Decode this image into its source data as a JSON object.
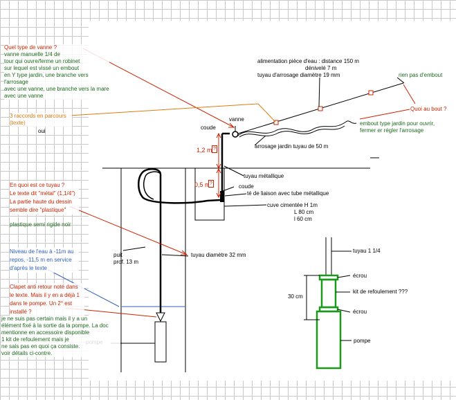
{
  "labels": {
    "alimentation": "alimentation pièce d'eau : distance 150 m",
    "denivele": "dénivelé 7 m",
    "tuyau_19mm": "tuyau d'arrosage diamètre 19 mm",
    "vanne": "vanne",
    "coude_top": "coude",
    "arrosage_jardin": "arrosage jardin tuyau de 50 m",
    "dim_1_2m": "1,2 m",
    "dim_0_5m": "0,5 m",
    "question_mark": "?",
    "tuyau_metallique": "tuyau métallique",
    "coude_bottom": "coude",
    "te_liaison": "té de liaison avec tube métallique",
    "cuve": "cuve cimentée H 1m",
    "cuve_l": "L 80 cm",
    "cuve_l2": "l 60 cm",
    "puits": "puit\nprof. 13 m",
    "tuyau_32mm": "tuyau diamètre 32 mm",
    "pompe": "pompe"
  },
  "detail": {
    "tuyau": "tuyau 1 1/4",
    "ecrou": "écrou",
    "kit": "kit de refoulement ???",
    "dim_30cm": "30 cm",
    "pompe": "pompe"
  },
  "annotations": {
    "valve_question": "Quel type de vanne ?",
    "valve_answer": "vanne manuelle 1/4 de\ntour qui ouvre/ferme un robinet\nsur lequel est vissé un embout\nen Y type jardin, une branche vers l'arrosage\navec une vanne, une branche vers la mare\n avec une vanne",
    "raccords": "3 raccords en parcours\n(texte)",
    "oui": "oui",
    "rien_embout": "rien pas d'embout",
    "quoi_bout": "Quoi au bout ?",
    "embout_jardin": "embout type jardin pour ouvrir,\nfermer er régler l'arrosage",
    "pipe_question": "En quoi est ce tuyau ?\nLe texte dit \"métal\" (1,1/4\")\nLa partie haute du dessin\nsemble dire \"plastique\"",
    "pipe_answer": "plastique semi rigide noir",
    "water_level": "Niveau de l'eau à -11m au\nrepos, -11,5 m en service\nd'après le texte",
    "check_valve": "Clapet anti retour noté dans\nle texte. Mais il y en a déjà 1\ndans le pompe. Un 2° est\ninstallé ?",
    "check_valve_answer": "je ne suis pas certain mais il y a un\nélément fixé à la sortie da la pompe. La doc\nmentionne en accessoire disponible\n1 kit de refoulement mais je\nne sais pas en quoi ça consiste.\nvoir détails ci-contre."
  },
  "colors": {
    "question_red": "#cc2200",
    "answer_green": "#1a6a1a",
    "orange": "#e07a10",
    "blue": "#3060c0",
    "detail_green": "#1a9a1a",
    "grid": "#c9c9c9"
  }
}
